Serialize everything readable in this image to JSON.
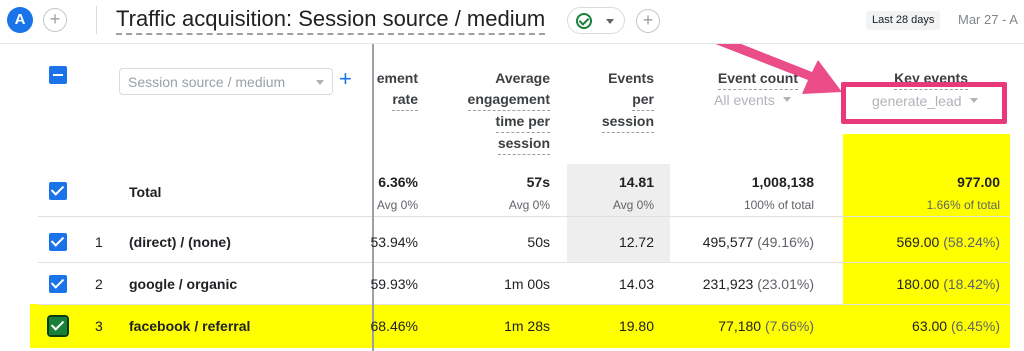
{
  "header": {
    "avatar_letter": "A",
    "title": "Traffic acquisition: Session source / medium",
    "date_badge": "Last 28 days",
    "date_range": "Mar 27 - A"
  },
  "dimension": {
    "placeholder": "Session source / medium",
    "add_symbol": "+"
  },
  "columns": {
    "engagement_rate": [
      "ement",
      "rate"
    ],
    "avg_engagement_time": [
      "Average",
      "engagement",
      "time per",
      "session"
    ],
    "events_per_session": [
      "Events",
      "per",
      "session"
    ],
    "event_count": "Event count",
    "event_count_filter": "All events",
    "key_events": "Key events",
    "key_events_filter": "generate_lead"
  },
  "totals": {
    "label": "Total",
    "engagement_rate": "6.36%",
    "engagement_rate_sub": "Avg 0%",
    "avg_time": "57s",
    "avg_time_sub": "Avg 0%",
    "events_per_session": "14.81",
    "events_per_session_sub": "Avg 0%",
    "event_count": "1,008,138",
    "event_count_sub": "100% of total",
    "key_events": "977.00",
    "key_events_sub": "1.66% of total"
  },
  "rows": [
    {
      "num": "1",
      "source": "(direct) / (none)",
      "engagement_rate": "53.94%",
      "avg_time": "50s",
      "events_per_session": "12.72",
      "event_count": "495,577",
      "event_count_pct": "(49.16%)",
      "key_events": "569.00",
      "key_events_pct": "(58.24%)"
    },
    {
      "num": "2",
      "source": "google / organic",
      "engagement_rate": "59.93%",
      "avg_time": "1m 00s",
      "events_per_session": "14.03",
      "event_count": "231,923",
      "event_count_pct": "(23.01%)",
      "key_events": "180.00",
      "key_events_pct": "(18.42%)"
    },
    {
      "num": "3",
      "source": "facebook / referral",
      "engagement_rate": "68.46%",
      "avg_time": "1m 28s",
      "events_per_session": "19.80",
      "event_count": "77,180",
      "event_count_pct": "(7.66%)",
      "key_events": "63.00",
      "key_events_pct": "(6.45%)"
    }
  ],
  "colors": {
    "accent": "#1a73e8",
    "highlight": "#ffff00",
    "annotation": "#e83a7a",
    "selected_checkbox": "#188038"
  }
}
